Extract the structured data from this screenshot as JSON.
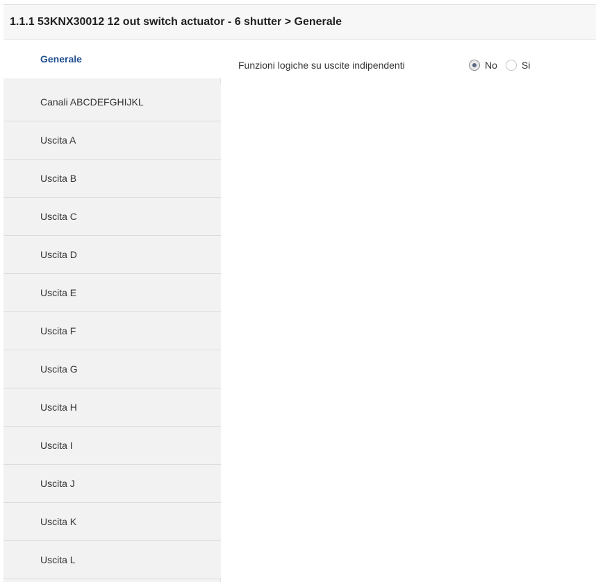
{
  "header": {
    "title": "1.1.1 53KNX30012 12 out switch actuator - 6 shutter > Generale"
  },
  "sidebar": {
    "items": [
      {
        "label": "Generale",
        "active": true
      },
      {
        "label": "Canali ABCDEFGHIJKL",
        "active": false
      },
      {
        "label": "Uscita A",
        "active": false
      },
      {
        "label": "Uscita B",
        "active": false
      },
      {
        "label": "Uscita C",
        "active": false
      },
      {
        "label": "Uscita D",
        "active": false
      },
      {
        "label": "Uscita E",
        "active": false
      },
      {
        "label": "Uscita F",
        "active": false
      },
      {
        "label": "Uscita G",
        "active": false
      },
      {
        "label": "Uscita H",
        "active": false
      },
      {
        "label": "Uscita I",
        "active": false
      },
      {
        "label": "Uscita J",
        "active": false
      },
      {
        "label": "Uscita K",
        "active": false
      },
      {
        "label": "Uscita L",
        "active": false
      }
    ]
  },
  "main": {
    "parameter": {
      "label": "Funzioni logiche su uscite indipendenti",
      "options": [
        {
          "label": "No",
          "selected": true
        },
        {
          "label": "Si",
          "selected": false
        }
      ]
    }
  },
  "colors": {
    "active_text": "#1f4f8f",
    "sidebar_bg": "#f2f2f2",
    "header_bg": "#f7f7f7"
  }
}
